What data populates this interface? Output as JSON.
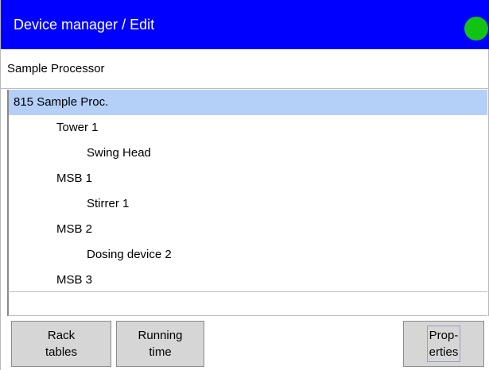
{
  "window": {
    "title": "Device manager / Edit",
    "status_color": "#13c313"
  },
  "subheader": {
    "text": "Sample Processor"
  },
  "tree": {
    "items": [
      {
        "label": "815 Sample Proc.",
        "level": 0,
        "selected": true
      },
      {
        "label": "Tower 1",
        "level": 1,
        "selected": false
      },
      {
        "label": "Swing Head",
        "level": 2,
        "selected": false
      },
      {
        "label": "MSB 1",
        "level": 1,
        "selected": false
      },
      {
        "label": "Stirrer 1",
        "level": 2,
        "selected": false
      },
      {
        "label": "MSB 2",
        "level": 1,
        "selected": false
      },
      {
        "label": "Dosing device 2",
        "level": 2,
        "selected": false
      },
      {
        "label": "MSB 3",
        "level": 1,
        "selected": false
      }
    ]
  },
  "toolbar": {
    "rack_tables": {
      "line1": "Rack",
      "line2": "tables"
    },
    "running_time": {
      "line1": "Running",
      "line2": "time"
    },
    "properties": {
      "line1": "Prop-",
      "line2": "erties"
    }
  },
  "colors": {
    "title_bar": "#0000ff",
    "selection": "#b4cff8",
    "button_bg": "#d6d6d6"
  }
}
